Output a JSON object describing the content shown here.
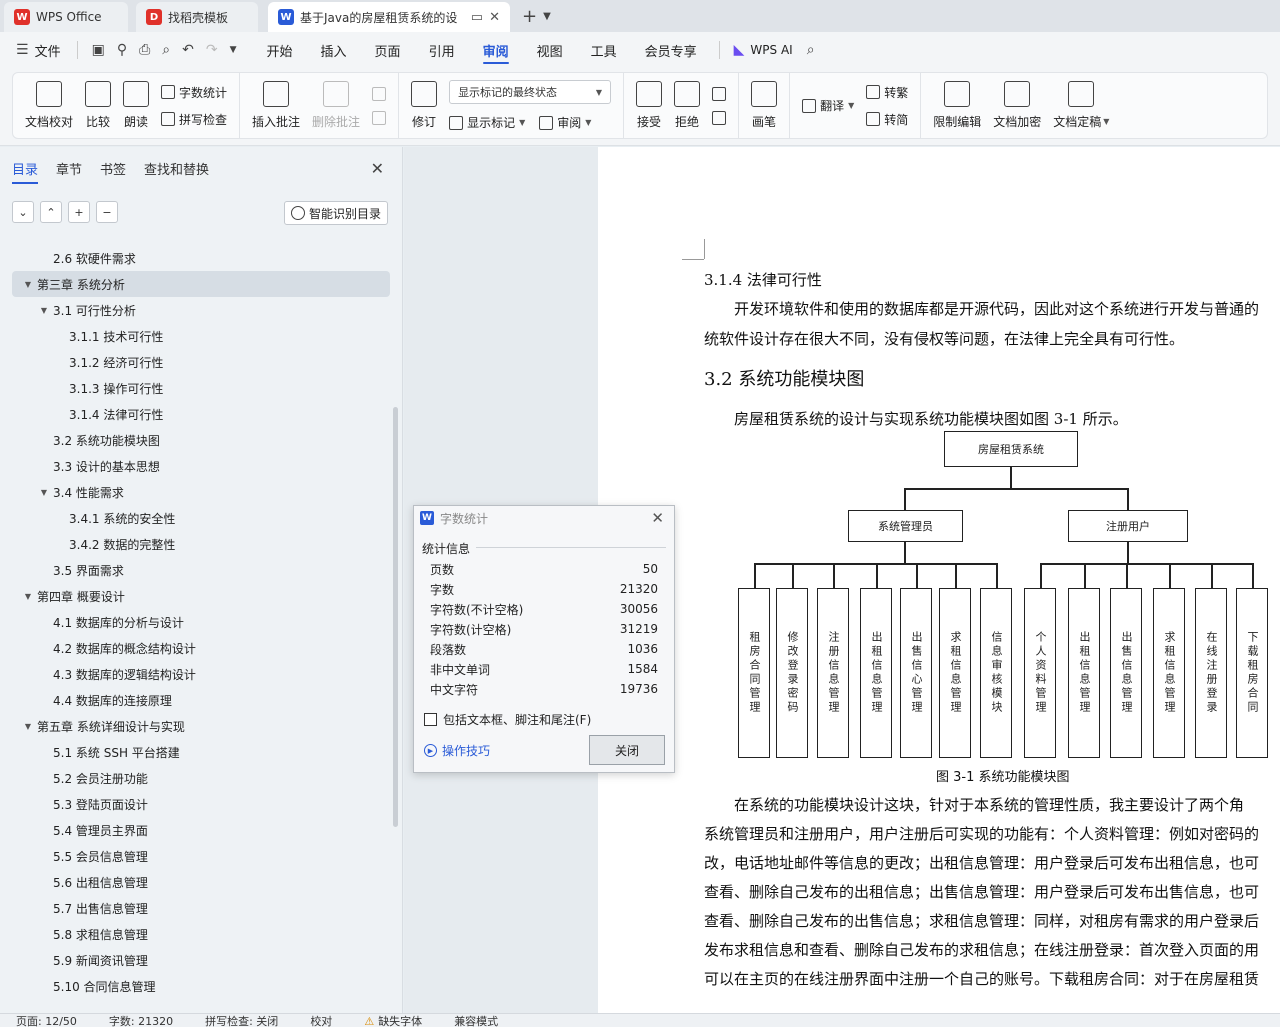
{
  "tabs": {
    "app": "WPS Office",
    "template": "找稻壳模板",
    "document": "基于Java的房屋租赁系统的设"
  },
  "menu": {
    "file": "文件",
    "items": [
      "开始",
      "插入",
      "页面",
      "引用",
      "审阅",
      "视图",
      "工具",
      "会员专享"
    ],
    "active": "审阅",
    "wps_ai": "WPS AI"
  },
  "ribbon": {
    "proofread": "文档校对",
    "compare": "比较",
    "read_aloud": "朗读",
    "word_count": "字数统计",
    "spell_check": "拼写检查",
    "insert_comment": "插入批注",
    "delete_comment": "删除批注",
    "track_changes": "修订",
    "show_markup": "显示标记",
    "markup_state": "显示标记的最终状态",
    "review": "审阅",
    "accept": "接受",
    "reject": "拒绝",
    "ink": "画笔",
    "translate": "翻译",
    "to_traditional": "转繁",
    "to_simplified": "转简",
    "restrict_edit": "限制编辑",
    "encrypt": "文档加密",
    "finalize": "文档定稿"
  },
  "nav": {
    "tabs": [
      "目录",
      "章节",
      "书签",
      "查找和替换"
    ],
    "smart_toc": "智能识别目录",
    "toc": [
      {
        "label": "2.6 软硬件需求",
        "level": 2,
        "tri": ""
      },
      {
        "label": "第三章  系统分析",
        "level": 1,
        "tri": "▼",
        "selected": true
      },
      {
        "label": "3.1 可行性分析",
        "level": 2,
        "tri": "▼"
      },
      {
        "label": "3.1.1 技术可行性",
        "level": 3,
        "tri": ""
      },
      {
        "label": "3.1.2 经济可行性",
        "level": 3,
        "tri": ""
      },
      {
        "label": "3.1.3 操作可行性",
        "level": 3,
        "tri": ""
      },
      {
        "label": "3.1.4 法律可行性",
        "level": 3,
        "tri": ""
      },
      {
        "label": "3.2 系统功能模块图",
        "level": 2,
        "tri": ""
      },
      {
        "label": "3.3 设计的基本思想",
        "level": 2,
        "tri": ""
      },
      {
        "label": "3.4 性能需求",
        "level": 2,
        "tri": "▼"
      },
      {
        "label": "3.4.1 系统的安全性",
        "level": 3,
        "tri": ""
      },
      {
        "label": "3.4.2 数据的完整性",
        "level": 3,
        "tri": ""
      },
      {
        "label": "3.5 界面需求",
        "level": 2,
        "tri": ""
      },
      {
        "label": "第四章  概要设计",
        "level": 1,
        "tri": "▼"
      },
      {
        "label": "4.1 数据库的分析与设计",
        "level": 2,
        "tri": ""
      },
      {
        "label": "4.2 数据库的概念结构设计",
        "level": 2,
        "tri": ""
      },
      {
        "label": "4.3 数据库的逻辑结构设计",
        "level": 2,
        "tri": ""
      },
      {
        "label": "4.4 数据库的连接原理",
        "level": 2,
        "tri": ""
      },
      {
        "label": "第五章  系统详细设计与实现",
        "level": 1,
        "tri": "▼"
      },
      {
        "label": "5.1 系统 SSH 平台搭建",
        "level": 2,
        "tri": ""
      },
      {
        "label": "5.2 会员注册功能",
        "level": 2,
        "tri": ""
      },
      {
        "label": "5.3 登陆页面设计",
        "level": 2,
        "tri": ""
      },
      {
        "label": "5.4 管理员主界面",
        "level": 2,
        "tri": ""
      },
      {
        "label": "5.5 会员信息管理",
        "level": 2,
        "tri": ""
      },
      {
        "label": "5.6 出租信息管理",
        "level": 2,
        "tri": ""
      },
      {
        "label": "5.7 出售信息管理",
        "level": 2,
        "tri": ""
      },
      {
        "label": "5.8 求租信息管理",
        "level": 2,
        "tri": ""
      },
      {
        "label": "5.9 新闻资讯管理",
        "level": 2,
        "tri": ""
      },
      {
        "label": "5.10 合同信息管理",
        "level": 2,
        "tri": ""
      }
    ]
  },
  "document": {
    "h_314": "3.1.4 法律可行性",
    "p_314_a": "开发环境软件和使用的数据库都是开源代码，因此对这个系统进行开发与普通的",
    "p_314_b": "统软件设计存在很大不同，没有侵权等问题，在法律上完全具有可行性。",
    "h_32": "3.2 系统功能模块图",
    "p_32": "房屋租赁系统的设计与实现系统功能模块图如图 3-1 所示。",
    "fig_caption": "图 3-1 系统功能模块图",
    "p_after": [
      "在系统的功能模块设计这块，针对于本系统的管理性质，我主要设计了两个角",
      "系统管理员和注册用户，用户注册后可实现的功能有：个人资料管理：例如对密码的",
      "改，电话地址邮件等信息的更改；出租信息管理：用户登录后可发布出租信息，也可",
      "查看、删除自己发布的出租信息；出售信息管理：用户登录后可发布出售信息，也可",
      "查看、删除自己发布的出售信息；求租信息管理：同样，对租房有需求的用户登录后",
      "发布求租信息和查看、删除自己发布的求租信息；在线注册登录：首次登入页面的用",
      "可以在主页的在线注册界面中注册一个自己的账号。下载租房合同：对于在房屋租赁"
    ]
  },
  "org_chart": {
    "root": "房屋租赁系统",
    "admin": "系统管理员",
    "user": "注册用户",
    "admin_children": [
      "租房合同管理",
      "修改登录密码",
      "注册信息管理",
      "出租信息管理",
      "出售信心管理",
      "求租信息管理",
      "信息审核模块"
    ],
    "user_children": [
      "个人资料管理",
      "出租信息管理",
      "出售信息管理",
      "求租信息管理",
      "在线注册登录",
      "下载租房合同"
    ]
  },
  "word_count_dialog": {
    "title": "字数统计",
    "section": "统计信息",
    "rows": [
      {
        "label": "页数",
        "value": "50"
      },
      {
        "label": "字数",
        "value": "21320"
      },
      {
        "label": "字符数(不计空格)",
        "value": "30056"
      },
      {
        "label": "字符数(计空格)",
        "value": "31219"
      },
      {
        "label": "段落数",
        "value": "1036"
      },
      {
        "label": "非中文单词",
        "value": "1584"
      },
      {
        "label": "中文字符",
        "value": "19736"
      }
    ],
    "include_label": "包括文本框、脚注和尾注(F)",
    "tips": "操作技巧",
    "close": "关闭"
  },
  "status": {
    "page": "页面: 12/50",
    "words": "字数: 21320",
    "spell": "拼写检查: 关闭",
    "proof": "校对",
    "missing_font": "缺失字体",
    "compat": "兼容模式"
  },
  "colors": {
    "accent": "#2a5bd7",
    "wps_red": "#e0312a"
  }
}
